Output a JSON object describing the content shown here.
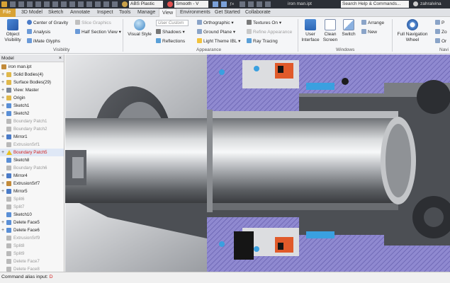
{
  "title_bar": {
    "material": "ABS Plastic",
    "appearance": "Smooth - V",
    "filename": "iron man.ipt",
    "search_placeholder": "Search Help & Commands...",
    "user": "zahralvina"
  },
  "tabs": [
    "File",
    "3D Model",
    "Sketch",
    "Annotate",
    "Inspect",
    "Tools",
    "Manage",
    "View",
    "Environments",
    "Get Started",
    "Collaborate"
  ],
  "active_tab": "View",
  "ribbon": {
    "visibility": {
      "label": "Visibility",
      "object_visibility": "Object\nVisibility",
      "center_of_gravity": "Center of Gravity",
      "slice_graphics": "Slice Graphics",
      "analysis": "Analysis",
      "half_section_view": "Half Section View",
      "imate_glyphs": "iMate Glyphs"
    },
    "appearance": {
      "label": "Appearance",
      "visual_style": "Visual Style",
      "user_custom": "User Custom",
      "shadows": "Shadows",
      "reflections": "Reflections",
      "orthographic": "Orthographic",
      "ground_plane": "Ground Plane",
      "light_theme": "Light Theme IBL",
      "textures_on": "Textures On",
      "refine_appearance": "Refine Appearance",
      "ray_tracing": "Ray Tracing"
    },
    "windows": {
      "label": "Windows",
      "user_interface": "User\nInterface",
      "clean_screen": "Clean\nScreen",
      "switch": "Switch",
      "arrange": "Arrange",
      "new": "New"
    },
    "navigate": {
      "label": "Navi",
      "full_nav_wheel": "Full Navigation\nWheel",
      "pan": "P",
      "zoom": "Zo",
      "orbit": "Or"
    }
  },
  "browser": {
    "header": "Model",
    "items": [
      {
        "label": "iron man.ipt",
        "expander": "",
        "icon": "part-icon",
        "color": "#c28a3a",
        "style": "normal"
      },
      {
        "label": "Solid Bodies(4)",
        "expander": "+",
        "icon": "folder-icon",
        "color": "#e0b84a",
        "style": "normal"
      },
      {
        "label": "Surface Bodies(29)",
        "expander": "+",
        "icon": "folder-icon",
        "color": "#e0b84a",
        "style": "normal"
      },
      {
        "label": "View: Master",
        "expander": "+",
        "icon": "view-icon",
        "color": "#7f8a99",
        "style": "normal"
      },
      {
        "label": "Origin",
        "expander": "+",
        "icon": "origin-icon",
        "color": "#e0b84a",
        "style": "normal"
      },
      {
        "label": "Sketch1",
        "expander": "+",
        "icon": "sketch-icon",
        "color": "#5a8fd6",
        "style": "normal"
      },
      {
        "label": "Sketch2",
        "expander": "+",
        "icon": "sketch-icon",
        "color": "#5a8fd6",
        "style": "normal"
      },
      {
        "label": "Boundary Patch1",
        "expander": "",
        "icon": "patch-icon",
        "color": "#b9b9b9",
        "style": "dim"
      },
      {
        "label": "Boundary Patch2",
        "expander": "",
        "icon": "patch-icon",
        "color": "#b9b9b9",
        "style": "dim"
      },
      {
        "label": "Mirror1",
        "expander": "+",
        "icon": "mirror-icon",
        "color": "#4a7bc8",
        "style": "normal"
      },
      {
        "label": "ExtrusionSrf1",
        "expander": "",
        "icon": "extrusion-icon",
        "color": "#b9b9b9",
        "style": "dim"
      },
      {
        "label": "Boundary Patch5",
        "expander": "+",
        "icon": "warning-icon",
        "color": "#e8c020",
        "style": "red"
      },
      {
        "label": "Sketch8",
        "expander": "",
        "icon": "sketch-icon",
        "color": "#5a8fd6",
        "style": "normal"
      },
      {
        "label": "Boundary Patch6",
        "expander": "",
        "icon": "patch-icon",
        "color": "#b9b9b9",
        "style": "dim"
      },
      {
        "label": "Mirror4",
        "expander": "+",
        "icon": "mirror-icon",
        "color": "#4a7bc8",
        "style": "normal"
      },
      {
        "label": "ExtrusionSrf7",
        "expander": "+",
        "icon": "extrusion-icon",
        "color": "#c28a3a",
        "style": "normal"
      },
      {
        "label": "Mirror5",
        "expander": "+",
        "icon": "mirror-icon",
        "color": "#4a7bc8",
        "style": "normal"
      },
      {
        "label": "Split6",
        "expander": "",
        "icon": "split-icon",
        "color": "#b9b9b9",
        "style": "dim"
      },
      {
        "label": "Split7",
        "expander": "",
        "icon": "split-icon",
        "color": "#b9b9b9",
        "style": "dim"
      },
      {
        "label": "Sketch10",
        "expander": "",
        "icon": "sketch-icon",
        "color": "#5a8fd6",
        "style": "normal"
      },
      {
        "label": "Delete Face5",
        "expander": "+",
        "icon": "delete-face-icon",
        "color": "#5a8fd6",
        "style": "normal"
      },
      {
        "label": "Delete Face6",
        "expander": "+",
        "icon": "delete-face-icon",
        "color": "#5a8fd6",
        "style": "normal"
      },
      {
        "label": "ExtrusionSrf9",
        "expander": "",
        "icon": "extrusion-icon",
        "color": "#b9b9b9",
        "style": "dim"
      },
      {
        "label": "Split8",
        "expander": "",
        "icon": "split-icon",
        "color": "#b9b9b9",
        "style": "dim"
      },
      {
        "label": "Split9",
        "expander": "",
        "icon": "split-icon",
        "color": "#b9b9b9",
        "style": "dim"
      },
      {
        "label": "Delete Face7",
        "expander": "",
        "icon": "delete-face-icon",
        "color": "#b9b9b9",
        "style": "dim"
      },
      {
        "label": "Delete Face8",
        "expander": "",
        "icon": "delete-face-icon",
        "color": "#b9b9b9",
        "style": "dim"
      }
    ]
  },
  "command_line": {
    "prompt": "Command alias input:",
    "value": "D"
  },
  "colors": {
    "file_tab": "#d8a234",
    "title_bar": "#2b2f36",
    "error_text": "#d21e1e",
    "section_hatch": "#7f78c8",
    "seal_orange": "#e0602a",
    "seal_blue": "#3aa0e0"
  }
}
